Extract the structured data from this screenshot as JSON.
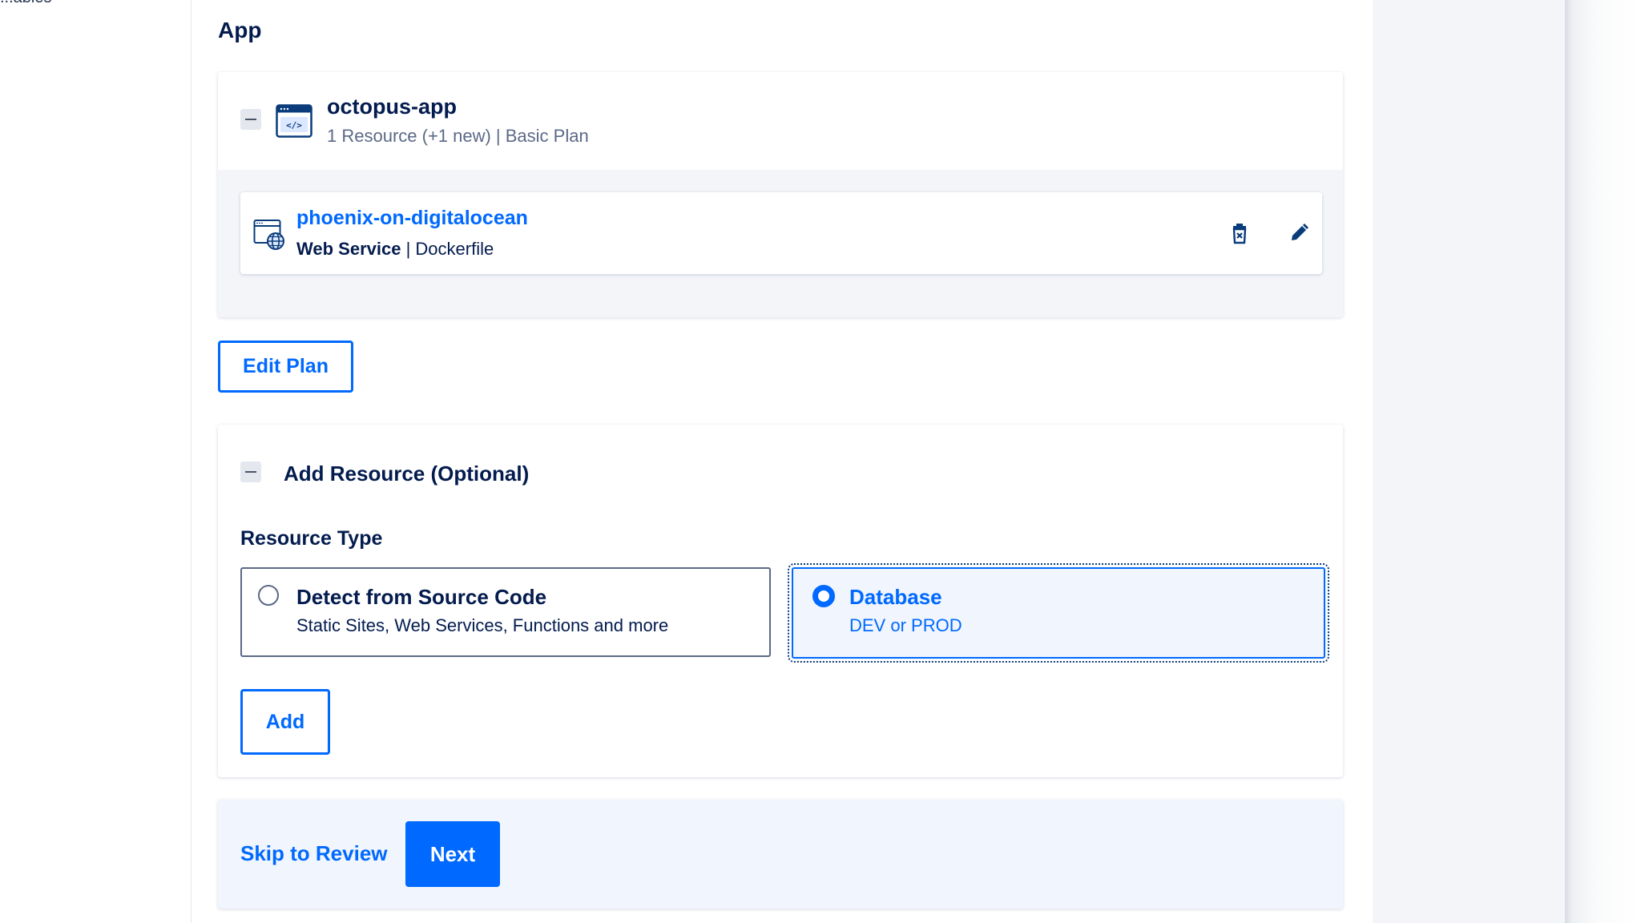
{
  "nav": {
    "cut_label": "...ables"
  },
  "section": {
    "title": "App"
  },
  "app": {
    "name": "octopus-app",
    "meta": "1 Resource (+1 new) | Basic Plan",
    "icon": "code-window-icon",
    "resource": {
      "name": "phoenix-on-digitalocean",
      "type": "Web Service",
      "separator": " | ",
      "source": "Dockerfile",
      "icon": "web-service-globe-icon"
    }
  },
  "edit_plan_label": "Edit Plan",
  "add_resource": {
    "title": "Add Resource (Optional)",
    "type_label": "Resource Type",
    "options": [
      {
        "title": "Detect from Source Code",
        "subtitle": "Static Sites, Web Services, Functions and more",
        "selected": false
      },
      {
        "title": "Database",
        "subtitle": "DEV or PROD",
        "selected": true
      }
    ],
    "add_label": "Add"
  },
  "footer": {
    "skip_label": "Skip to Review",
    "next_label": "Next"
  },
  "colors": {
    "accent": "#0069ff",
    "text": "#031b4e",
    "muted": "#5b6987",
    "panel": "#f3f5f9"
  }
}
